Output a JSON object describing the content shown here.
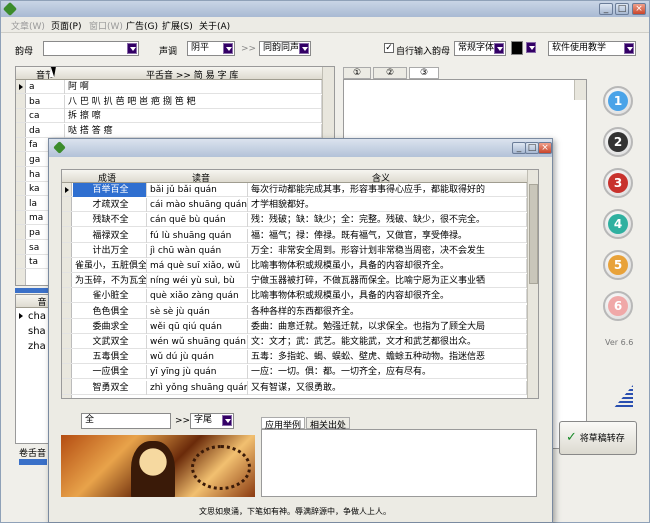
{
  "main": {
    "menu": [
      {
        "label": "文章(W)",
        "disabled": true
      },
      {
        "label": "页面(P)",
        "disabled": false
      },
      {
        "label": "窗口(W)",
        "disabled": true
      },
      {
        "label": "广告(G)",
        "disabled": false
      },
      {
        "label": "扩展(S)",
        "disabled": false
      },
      {
        "label": "关于(A)",
        "disabled": false
      }
    ],
    "toolbar": {
      "rhyme_label": "韵母",
      "tone_label": "声调",
      "tone_value": "阴平",
      "arrow": ">>",
      "rhyme_mode_value": "同韵同声",
      "custom_rhyme_label": "自行输入韵母",
      "font_value": "常规字体",
      "usage_value": "软件使用教学"
    },
    "rhyme_grid": {
      "col_rhyme": "音节",
      "col_chars": "平舌音 >> 简 易 字 库",
      "rows": [
        {
          "rhyme": "a",
          "chars": "阿 啊"
        },
        {
          "rhyme": "ba",
          "chars": "八 巴 叭 扒 芭 吧 岜 疤 捌 笆 粑"
        },
        {
          "rhyme": "ca",
          "chars": "拆 擦 嚓"
        },
        {
          "rhyme": "da",
          "chars": "哒 搭 答 瘩"
        },
        {
          "rhyme": "fa",
          "chars": ""
        },
        {
          "rhyme": "ga",
          "chars": ""
        },
        {
          "rhyme": "ha",
          "chars": ""
        },
        {
          "rhyme": "ka",
          "chars": ""
        },
        {
          "rhyme": "la",
          "chars": ""
        },
        {
          "rhyme": "ma",
          "chars": ""
        },
        {
          "rhyme": "pa",
          "chars": ""
        },
        {
          "rhyme": "sa",
          "chars": ""
        },
        {
          "rhyme": "ta",
          "chars": ""
        }
      ]
    },
    "retro_grid": {
      "col": "音",
      "rows": [
        "cha",
        "sha",
        "zha"
      ]
    },
    "right_tabs": [
      "①",
      "②",
      "③"
    ],
    "side_buttons": [
      "1",
      "2",
      "3",
      "4",
      "5",
      "6"
    ],
    "version": "Ver 6.6",
    "bottom_left_label": "卷舌音",
    "save_button": "将草稿转存"
  },
  "dialog": {
    "headers": {
      "idiom": "成语",
      "pinyin": "读音",
      "meaning": "含义"
    },
    "rows": [
      {
        "idiom": "百举百全",
        "pinyin": "bǎi jǔ bǎi quán",
        "meaning": "每次行动都能完成其事，形容事事得心应手，都能取得好的"
      },
      {
        "idiom": "才疏双全",
        "pinyin": "cái mào shuāng quán",
        "meaning": "才学相貌都好。"
      },
      {
        "idiom": "残缺不全",
        "pinyin": "cán quē bù quán",
        "meaning": "残：残破；缺：缺少；全：完整。残破、缺少，很不完全。"
      },
      {
        "idiom": "福禄双全",
        "pinyin": "fú lù shuāng quán",
        "meaning": "福：福气；禄：俸禄。既有福气，又做官，享受俸禄。"
      },
      {
        "idiom": "计出万全",
        "pinyin": "jì chū wàn quán",
        "meaning": "万全：非常安全周到。形容计划非常稳当周密，决不会发生"
      },
      {
        "idiom": "雀虽小，五脏俱全",
        "pinyin": "má què suī xiǎo, wǔ",
        "meaning": "比喻事物体积或规模虽小，具备的内容却很齐全。"
      },
      {
        "idiom": "为玉碎，不为瓦全",
        "pinyin": "níng wéi yù suì, bù",
        "meaning": "宁做玉器被打碎，不做瓦器而保全。比喻宁愿为正义事业牺"
      },
      {
        "idiom": "雀小脏全",
        "pinyin": "què xiǎo zàng quán",
        "meaning": "比喻事物体积或规模虽小，具备的内容却很齐全。"
      },
      {
        "idiom": "色色俱全",
        "pinyin": "sè sè jù quán",
        "meaning": "各种各样的东西都很齐全。"
      },
      {
        "idiom": "委曲求全",
        "pinyin": "wěi qū qiú quán",
        "meaning": "委曲：曲意迁就。勉强迁就，以求保全。也指为了顾全大局"
      },
      {
        "idiom": "文武双全",
        "pinyin": "wén wǔ shuāng quán",
        "meaning": "文：文才；武：武艺。能文能武，文才和武艺都很出众。"
      },
      {
        "idiom": "五毒俱全",
        "pinyin": "wǔ dú jù quán",
        "meaning": "五毒：多指蛇、蝎、蜈蚣、壁虎、蟾蜍五种动物。指迷信恶"
      },
      {
        "idiom": "一应俱全",
        "pinyin": "yī yīng jù quán",
        "meaning": "一应：一切。俱：都。一切齐全，应有尽有。"
      },
      {
        "idiom": "智勇双全",
        "pinyin": "zhì yǒng shuāng quán",
        "meaning": "又有智谋，又很勇敢。"
      }
    ],
    "search_value": "全",
    "search_arrow": ">>",
    "position_value": "字尾",
    "tabs": [
      "应用举例",
      "相关出处"
    ],
    "footer": "文思如泉涌，下笔如有神。辱满辞源中，争做人上人。"
  }
}
